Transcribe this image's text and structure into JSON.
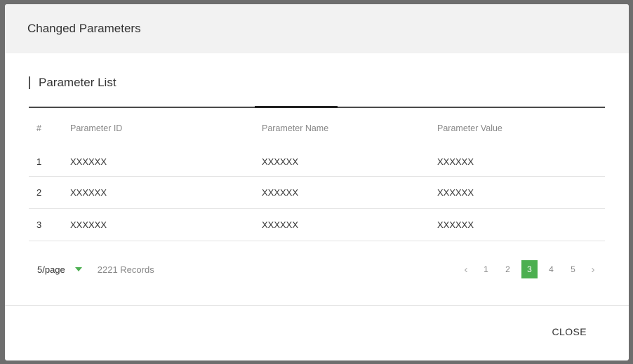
{
  "dialog": {
    "title": "Changed Parameters",
    "section_title": "Parameter List",
    "close_label": "CLOSE"
  },
  "table": {
    "columns": [
      "#",
      "Parameter ID",
      "Parameter Name",
      "Parameter Value"
    ],
    "rows": [
      {
        "num": "1",
        "id": "XXXXXX",
        "name": "XXXXXX",
        "value": "XXXXXX"
      },
      {
        "num": "2",
        "id": "XXXXXX",
        "name": "XXXXXX",
        "value": "XXXXXX"
      },
      {
        "num": "3",
        "id": "XXXXXX",
        "name": "XXXXXX",
        "value": "XXXXXX"
      }
    ]
  },
  "pagination": {
    "page_size": "5/page",
    "records": "2221 Records",
    "prev": "‹",
    "next": "›",
    "pages": [
      "1",
      "2",
      "3",
      "4",
      "5"
    ],
    "current_page": "3"
  },
  "colors": {
    "accent": "#4caf50",
    "header_bg": "#f2f2f2",
    "overlay": "#6e6e6e"
  }
}
